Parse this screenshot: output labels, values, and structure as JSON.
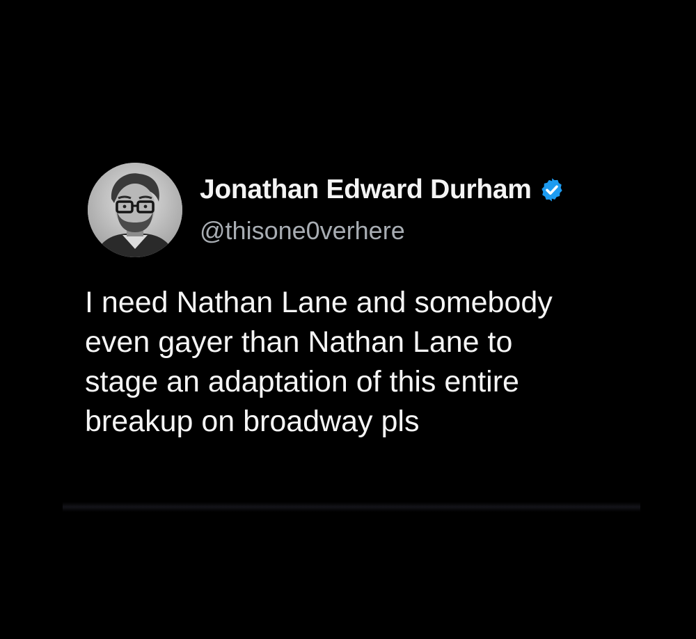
{
  "author": {
    "name": "Jonathan Edward Durham",
    "handle": "@thisone0verhere",
    "verified": true,
    "verified_badge_color": "#1d9bf0",
    "avatar_icon": "profile-photo"
  },
  "tweet": {
    "lines": [
      "I need Nathan Lane and somebody",
      "even gayer than Nathan Lane to",
      "stage an adaptation of this entire",
      "breakup on broadway pls"
    ]
  },
  "theme": {
    "background": "#000000",
    "text": "#f5f5f5",
    "handle_text": "#a8adb3"
  }
}
